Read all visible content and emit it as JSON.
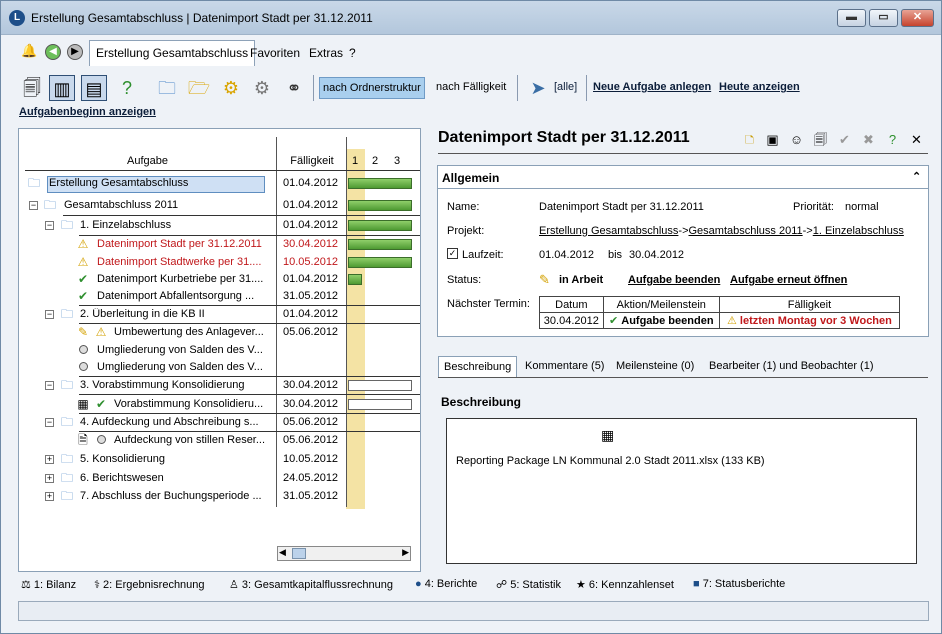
{
  "window": {
    "title": "Erstellung Gesamtabschluss | Datenimport Stadt per 31.12.2011",
    "controls": {
      "minimize": "▬",
      "maximize": "▭",
      "close": "✕"
    }
  },
  "menu": {
    "active_tab": "Erstellung Gesamtabschluss",
    "items": [
      "Favoriten",
      "Extras",
      "?"
    ]
  },
  "toolbar": {
    "view_ordner": "nach Ordnerstruktur",
    "view_faelligkeit": "nach Fälligkeit",
    "filter_all": "[alle]",
    "new_task": "Neue Aufgabe anlegen",
    "today": "Heute anzeigen",
    "show_start": "Aufgabenbeginn anzeigen"
  },
  "tree": {
    "col_task": "Aufgabe",
    "col_due": "Fälligkeit",
    "gantt_cols": [
      "1",
      "2",
      "3"
    ],
    "rows": [
      {
        "label": "Erstellung Gesamtabschluss",
        "date": "01.04.2012"
      },
      {
        "label": "Gesamtabschluss 2011",
        "date": "01.04.2012"
      },
      {
        "label": "1. Einzelabschluss",
        "date": "01.04.2012"
      },
      {
        "label": "Datenimport Stadt per 31.12.2011",
        "date": "30.04.2012"
      },
      {
        "label": "Datenimport Stadtwerke per 31....",
        "date": "10.05.2012"
      },
      {
        "label": "Datenimport Kurbetriebe per 31....",
        "date": "01.04.2012"
      },
      {
        "label": "Datenimport Abfallentsorgung ...",
        "date": "31.05.2012"
      },
      {
        "label": "2. Überleitung in die KB II",
        "date": "01.04.2012"
      },
      {
        "label": "Umbewertung des Anlagever...",
        "date": "05.06.2012"
      },
      {
        "label": "Umgliederung von Salden des V...",
        "date": ""
      },
      {
        "label": "Umgliederung von Salden des V...",
        "date": ""
      },
      {
        "label": "3. Vorabstimmung Konsolidierung",
        "date": "30.04.2012"
      },
      {
        "label": "Vorabstimmung Konsolidieru...",
        "date": "30.04.2012"
      },
      {
        "label": "4. Aufdeckung und Abschreibung s...",
        "date": "05.06.2012"
      },
      {
        "label": "Aufdeckung von stillen Reser...",
        "date": "05.06.2012"
      },
      {
        "label": "5. Konsolidierung",
        "date": "10.05.2012"
      },
      {
        "label": "6. Berichtswesen",
        "date": "24.05.2012"
      },
      {
        "label": "7. Abschluss der Buchungsperiode ...",
        "date": "31.05.2012"
      }
    ]
  },
  "detail": {
    "title": "Datenimport Stadt per 31.12.2011",
    "section_general": "Allgemein",
    "collapse": "⌃",
    "name_label": "Name:",
    "name_value": "Datenimport Stadt per 31.12.2011",
    "priority_label": "Priorität:",
    "priority_value": "normal",
    "project_label": "Projekt:",
    "project_path": [
      "Erstellung Gesamtabschluss",
      "Gesamtabschluss 2011",
      "1. Einzelabschluss"
    ],
    "project_sep": "->",
    "runtime_label": "Laufzeit:",
    "runtime_from": "01.04.2012",
    "runtime_bis": "bis",
    "runtime_to": "30.04.2012",
    "status_label": "Status:",
    "status_value": "in Arbeit",
    "action_finish": "Aufgabe beenden",
    "action_reopen": "Aufgabe erneut öffnen",
    "next_label": "Nächster Termin:",
    "next_table": {
      "headers": [
        "Datum",
        "Aktion/Meilenstein",
        "Fälligkeit"
      ],
      "row": [
        "30.04.2012",
        "Aufgabe beenden",
        "letzten Montag vor 3 Wochen"
      ]
    }
  },
  "tabs": [
    "Beschreibung",
    "Kommentare (5)",
    "Meilensteine (0)",
    "Bearbeiter (1) und Beobachter (1)"
  ],
  "description": {
    "heading": "Beschreibung",
    "file": "Reporting Package LN Kommunal 2.0 Stadt 2011.xlsx (133 KB)"
  },
  "bottom_nav": [
    "1: Bilanz",
    "2: Ergebnisrechnung",
    "3: Gesamtkapitalflussrechnung",
    "4: Berichte",
    "5: Statistik",
    "6: Kennzahlenset",
    "7: Statusberichte"
  ]
}
